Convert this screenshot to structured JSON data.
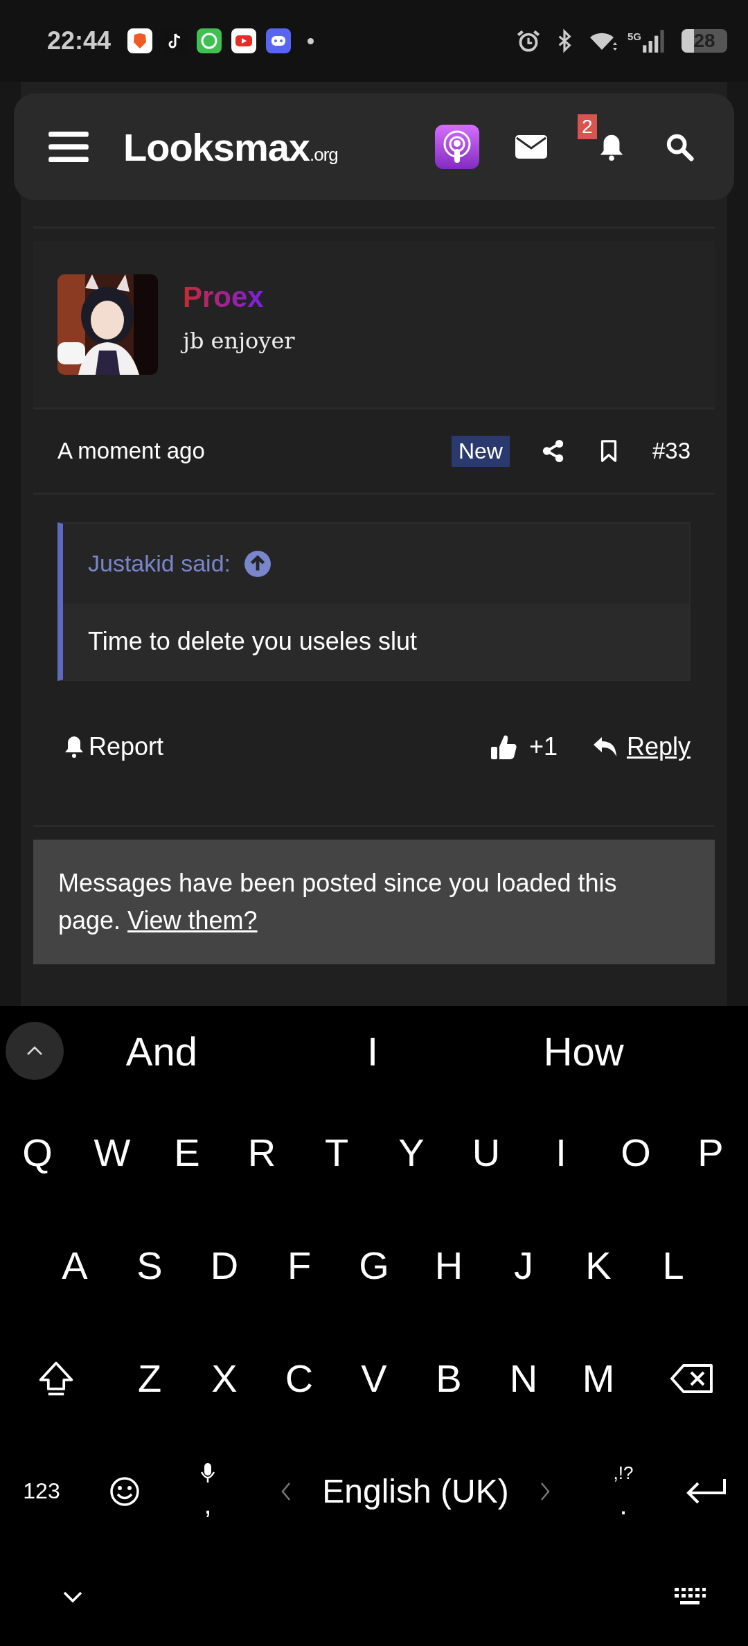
{
  "status_bar": {
    "time": "22:44",
    "network": "5G",
    "battery": "28"
  },
  "header": {
    "logo": "Looksmax",
    "logo_suffix": ".org",
    "notification_count": "2"
  },
  "post": {
    "author": "Proex",
    "user_title": "jb enjoyer",
    "time": "A moment ago",
    "badge": "New",
    "post_number": "#33",
    "quote": {
      "author": "Justakid said:",
      "text": "Time to delete you useles slut"
    },
    "actions": {
      "report": "Report",
      "reaction_count": "+1",
      "reply": "Reply"
    }
  },
  "banner": {
    "text": "Messages have been posted since you loaded this page.",
    "link": "View them?"
  },
  "keyboard": {
    "suggestions": [
      "And",
      "I",
      "How"
    ],
    "rows": [
      [
        "Q",
        "W",
        "E",
        "R",
        "T",
        "Y",
        "U",
        "I",
        "O",
        "P"
      ],
      [
        "A",
        "S",
        "D",
        "F",
        "G",
        "H",
        "J",
        "K",
        "L"
      ],
      [
        "Z",
        "X",
        "C",
        "V",
        "B",
        "N",
        "M"
      ]
    ],
    "numbers_key": "123",
    "comma_key": ",",
    "language": "English (UK)",
    "punctuation_key": ",!?",
    "period_key": "."
  }
}
